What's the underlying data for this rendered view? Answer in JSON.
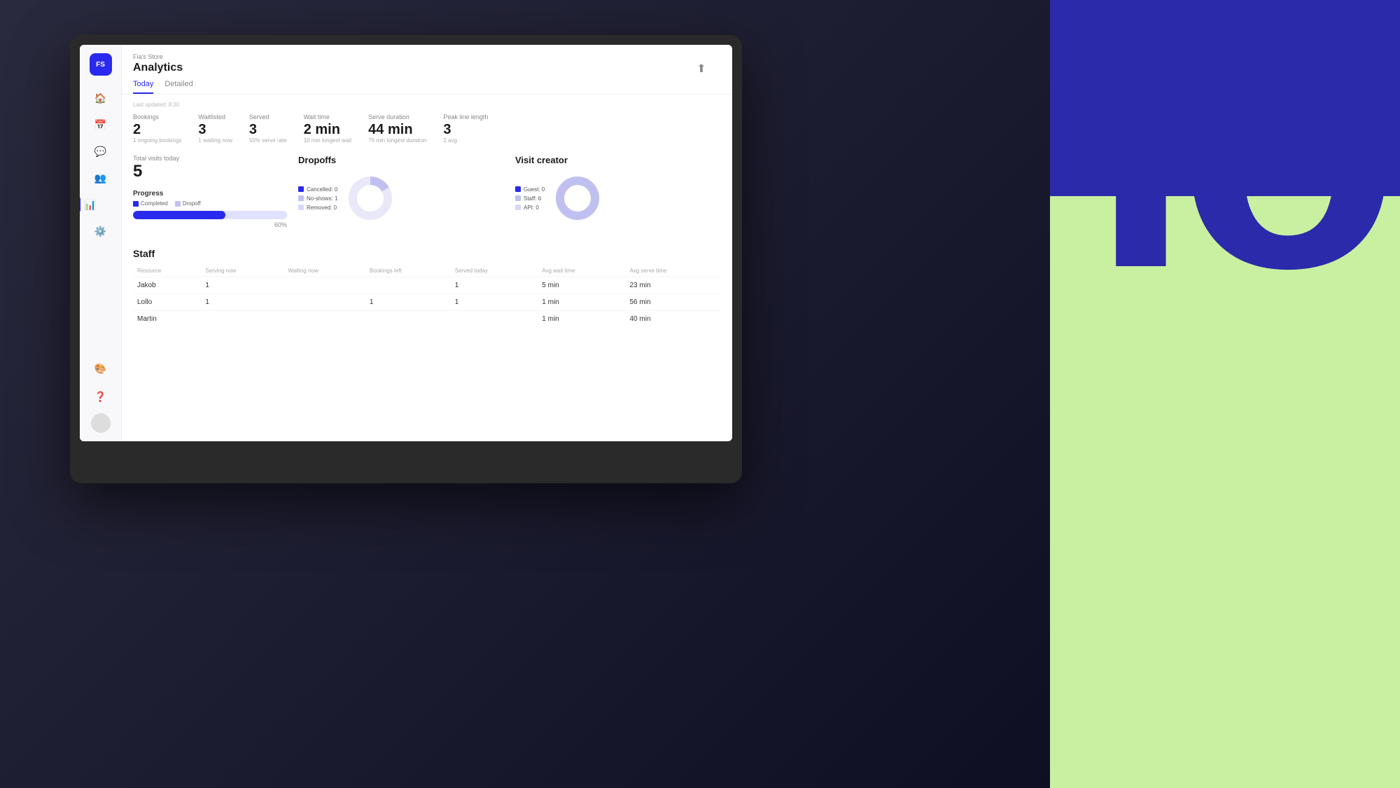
{
  "app": {
    "store_name": "Fia's Store",
    "page_title": "Analytics",
    "tabs": [
      {
        "label": "Today",
        "active": true
      },
      {
        "label": "Detailed",
        "active": false
      }
    ],
    "last_updated": "Last updated: 8:30"
  },
  "stats": {
    "bookings": {
      "label": "Bookings",
      "value": "2",
      "sub": "1 ongoing bookings"
    },
    "waitlisted": {
      "label": "Waitlisted",
      "value": "3",
      "sub": "1 waiting now"
    },
    "served": {
      "label": "Served",
      "value": "3",
      "sub": "55% serve rate"
    },
    "wait_time": {
      "label": "Wait time",
      "value": "2 min",
      "sub": "10 min longest wait"
    },
    "serve_duration": {
      "label": "Serve duration",
      "value": "44 min",
      "sub": "75 min longest duration"
    },
    "peak_line": {
      "label": "Peak line length",
      "value": "3",
      "sub": "2 avg"
    }
  },
  "total_visits": {
    "label": "Total visits today",
    "value": "5"
  },
  "progress": {
    "label": "Progress",
    "legend": [
      {
        "label": "Completed",
        "color": "#2a2aee"
      },
      {
        "label": "Dropoff",
        "color": "#c0c0f0"
      }
    ],
    "value": 60,
    "display": "60%"
  },
  "dropoffs": {
    "title": "Dropoffs",
    "legend": [
      {
        "label": "Cancelled: 0",
        "color": "#2a2aee"
      },
      {
        "label": "No-shows: 1",
        "color": "#c0c0f0"
      },
      {
        "label": "Removed: 0",
        "color": "#d8d8f8"
      }
    ],
    "donut": {
      "segments": [
        {
          "value": 1,
          "color": "#c0c0f0"
        },
        {
          "value": 5,
          "color": "#e8e8f8"
        }
      ]
    }
  },
  "visit_creator": {
    "title": "Visit creator",
    "legend": [
      {
        "label": "Guest: 0",
        "color": "#2a2aee"
      },
      {
        "label": "Staff: 6",
        "color": "#c0c0f0"
      },
      {
        "label": "API: 0",
        "color": "#d8d8f8"
      }
    ],
    "donut": {
      "segments": [
        {
          "value": 6,
          "color": "#c0c0f0"
        },
        {
          "value": 0,
          "color": "#e8e8f8"
        }
      ]
    }
  },
  "staff": {
    "title": "Staff",
    "columns": [
      "Resource",
      "Serving now",
      "Waiting now",
      "Bookings left",
      "Served today",
      "Avg wait time",
      "Avg serve time"
    ],
    "rows": [
      {
        "name": "Jakob",
        "serving_now": "1",
        "waiting_now": "",
        "bookings_left": "",
        "served_today": "1",
        "avg_wait": "5 min",
        "avg_serve": "23 min"
      },
      {
        "name": "Lollo",
        "serving_now": "1",
        "waiting_now": "",
        "bookings_left": "1",
        "served_today": "1",
        "avg_wait": "1 min",
        "avg_serve": "56 min"
      },
      {
        "name": "Martin",
        "serving_now": "",
        "waiting_now": "",
        "bookings_left": "",
        "served_today": "",
        "avg_wait": "1 min",
        "avg_serve": "40 min"
      }
    ]
  },
  "sidebar": {
    "logo": "FS",
    "icons": [
      "🏠",
      "📅",
      "💬",
      "👥",
      "📊",
      "⚙️"
    ],
    "bottom_icons": [
      "🎨",
      "❓"
    ]
  },
  "deco_letters": "lo"
}
